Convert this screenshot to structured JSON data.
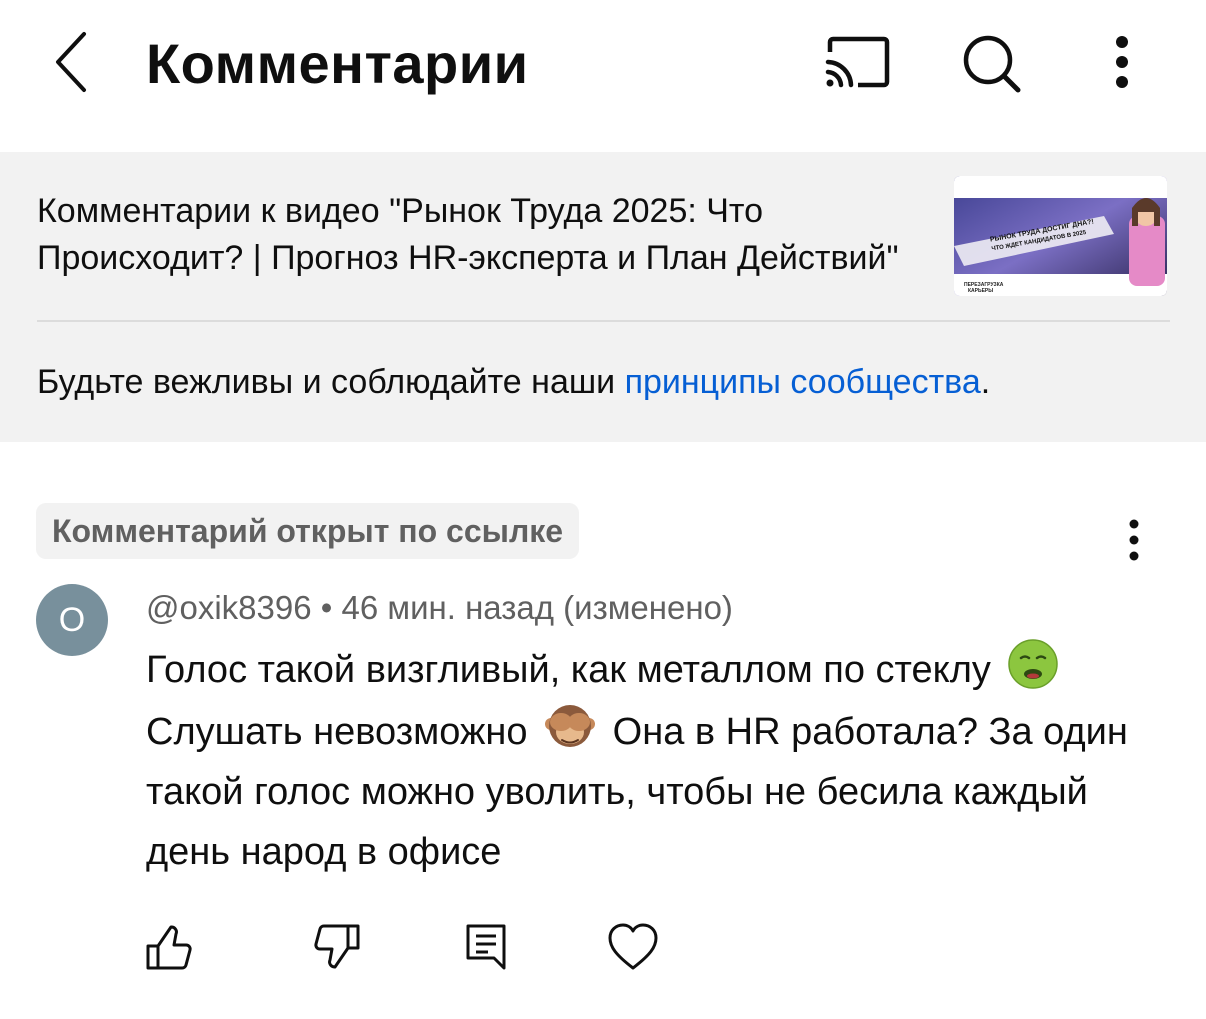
{
  "header": {
    "title": "Комментарии",
    "back_icon": "chevron-left-icon",
    "cast_icon": "cast-icon",
    "search_icon": "search-icon",
    "more_icon": "more-vert-icon"
  },
  "video": {
    "title": "Комментарии к видео \"Рынок Труда 2025: Что Происходит? | Прогноз HR-эксперта и План Действий\"",
    "thumbnail": {
      "headline_line1": "РЫНОК ТРУДА ДОСТИГ ДНА?!",
      "headline_line2": "ЧТО ЖДЕТ КАНДИДАТОВ В 2025",
      "caption_line1": "ПЕРЕЗАГРУЗКА",
      "caption_line2": "КАРЬЕРЫ"
    }
  },
  "rules": {
    "prefix": "Будьте вежливы и соблюдайте наши ",
    "link": "принципы сообщества",
    "suffix": "."
  },
  "comment": {
    "highlight_chip": "Комментарий открыт по ссылке",
    "avatar_letter": "O",
    "author": "@oxik8396",
    "separator": "•",
    "time": "46 мин. назад (изменено)",
    "text_part1": "Голос такой визгливый, как металлом по стеклу",
    "emoji1": "nauseated-face",
    "text_part2": "Слушать невозможно",
    "emoji2": "see-no-evil-monkey",
    "text_part3": "Она в HR работала? За один такой голос можно уволить, чтобы не бесила каждый день народ в офисе",
    "actions": [
      "thumb-up-icon",
      "thumb-down-icon",
      "reply-icon",
      "heart-icon"
    ]
  },
  "colors": {
    "link": "#065fd4",
    "panel_bg": "#f2f2f2",
    "secondary_text": "#606060",
    "avatar_bg": "#78909c"
  }
}
